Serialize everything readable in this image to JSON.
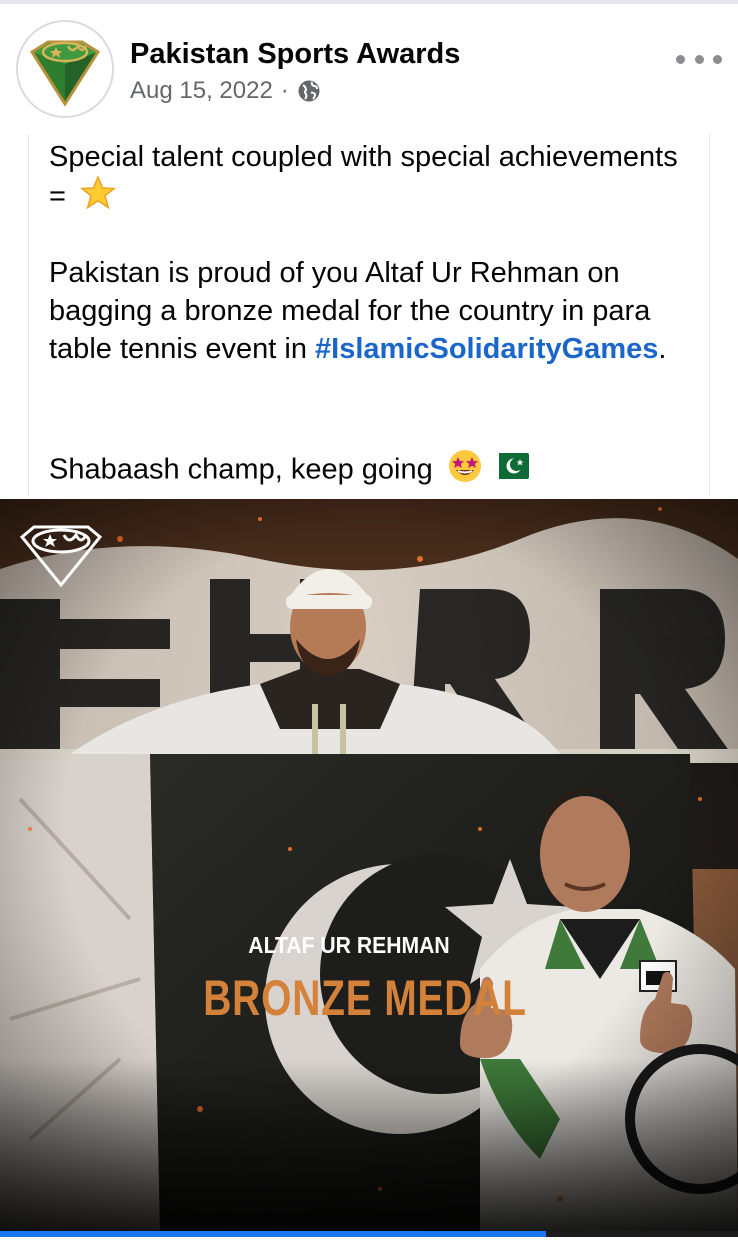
{
  "post": {
    "author": "Pakistan Sports Awards",
    "date": "Aug 15, 2022",
    "separator": "·",
    "visibility_icon": "globe-icon",
    "more_icon": "more-options-icon"
  },
  "text": {
    "line1": "Special talent coupled with special achievements  = ",
    "line1_emoji": "star-emoji",
    "para2_before": "Pakistan is proud of you Altaf Ur Rehman on bagging a bronze medal for the country in para table tennis event in ",
    "hashtag": "#IslamicSolidarityGames",
    "para2_after": ".",
    "para3": "Shabaash champ, keep going ",
    "para3_emojis": [
      "star-struck-emoji",
      "pakistan-flag-emoji"
    ]
  },
  "image": {
    "athlete_name": "ALTAF UR REHMAN",
    "medal": "BRONZE MEDAL",
    "logo_icon": "sports-awards-logo-icon"
  },
  "video_progress": 0.74,
  "colors": {
    "hashtag": "#1b66c9",
    "medal_text": "#d4813a",
    "progress": "#1877f2",
    "meta": "#65676b",
    "avatar_green": "#2f7d2f",
    "avatar_gold": "#b8923a"
  }
}
